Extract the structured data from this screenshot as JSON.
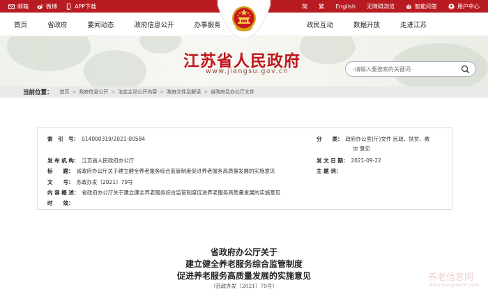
{
  "colors": {
    "brand_red": "#b81c22",
    "title_red": "#c0151c"
  },
  "topbar": {
    "left": [
      {
        "label": "邮箱",
        "icon": "mail-icon"
      },
      {
        "label": "微博",
        "icon": "weibo-icon"
      },
      {
        "label": "APP下载",
        "icon": "phone-icon"
      }
    ],
    "right": [
      {
        "label": "简"
      },
      {
        "label": "繁"
      },
      {
        "label": "English"
      },
      {
        "label": "无障碍浏览"
      },
      {
        "label": "智能问答",
        "icon": "robot-icon"
      },
      {
        "label": "用户中心",
        "icon": "user-icon"
      }
    ]
  },
  "nav": {
    "left": [
      "首页",
      "省政府",
      "要闻动态",
      "政府信息公开",
      "办事服务"
    ],
    "right": [
      "政民互动",
      "数据开放",
      "走进江苏"
    ]
  },
  "header": {
    "site_title": "江苏省人民政府",
    "site_url": "www.jiangsu.gov.cn",
    "search_placeholder": "-请输入要搜索的关键词-"
  },
  "breadcrumb": {
    "label": "当前位置：",
    "items": [
      "首页",
      "政府信息公开",
      "法定主动公开内容",
      "政府文件及解读",
      "省政府及办公厅文件"
    ]
  },
  "info": {
    "index_k": "索　引　号：",
    "index_v": "014000319/2021-00584",
    "category_k": "分　　类：",
    "category_v1": "政府办公室(厅)文件 民政、扶贫、救",
    "category_v2": "灾 意见",
    "issuer_k": "发 布 机 构：",
    "issuer_v": "江苏省人民政府办公厅",
    "date_k": "发 文 日 期：",
    "date_v": "2021-09-22",
    "title_k": "标　　题：",
    "title_v": "省政府办公厅关于建立健全养老服务综合监管制度促进养老服务高质量发展的实施意见",
    "subject_k": "主 题 词：",
    "docno_k": "文　　号：",
    "docno_v": "苏政办发〔2021〕79号",
    "summary_k": "内 容 概 述：",
    "summary_v": "省政府办公厅关于建立健全养老服务综合监管制度促进养老服务高质量发展的实施意见",
    "validity_k": "时　　效："
  },
  "article": {
    "line1": "省政府办公厅关于",
    "line2": "建立健全养老服务综合监管制度",
    "line3": "促进养老服务高质量发展的实施意见",
    "docno": "（苏政办发〔2021〕79号）"
  },
  "watermark": {
    "line1": "养老信息网",
    "line2": "www.yanglaocn.com"
  }
}
